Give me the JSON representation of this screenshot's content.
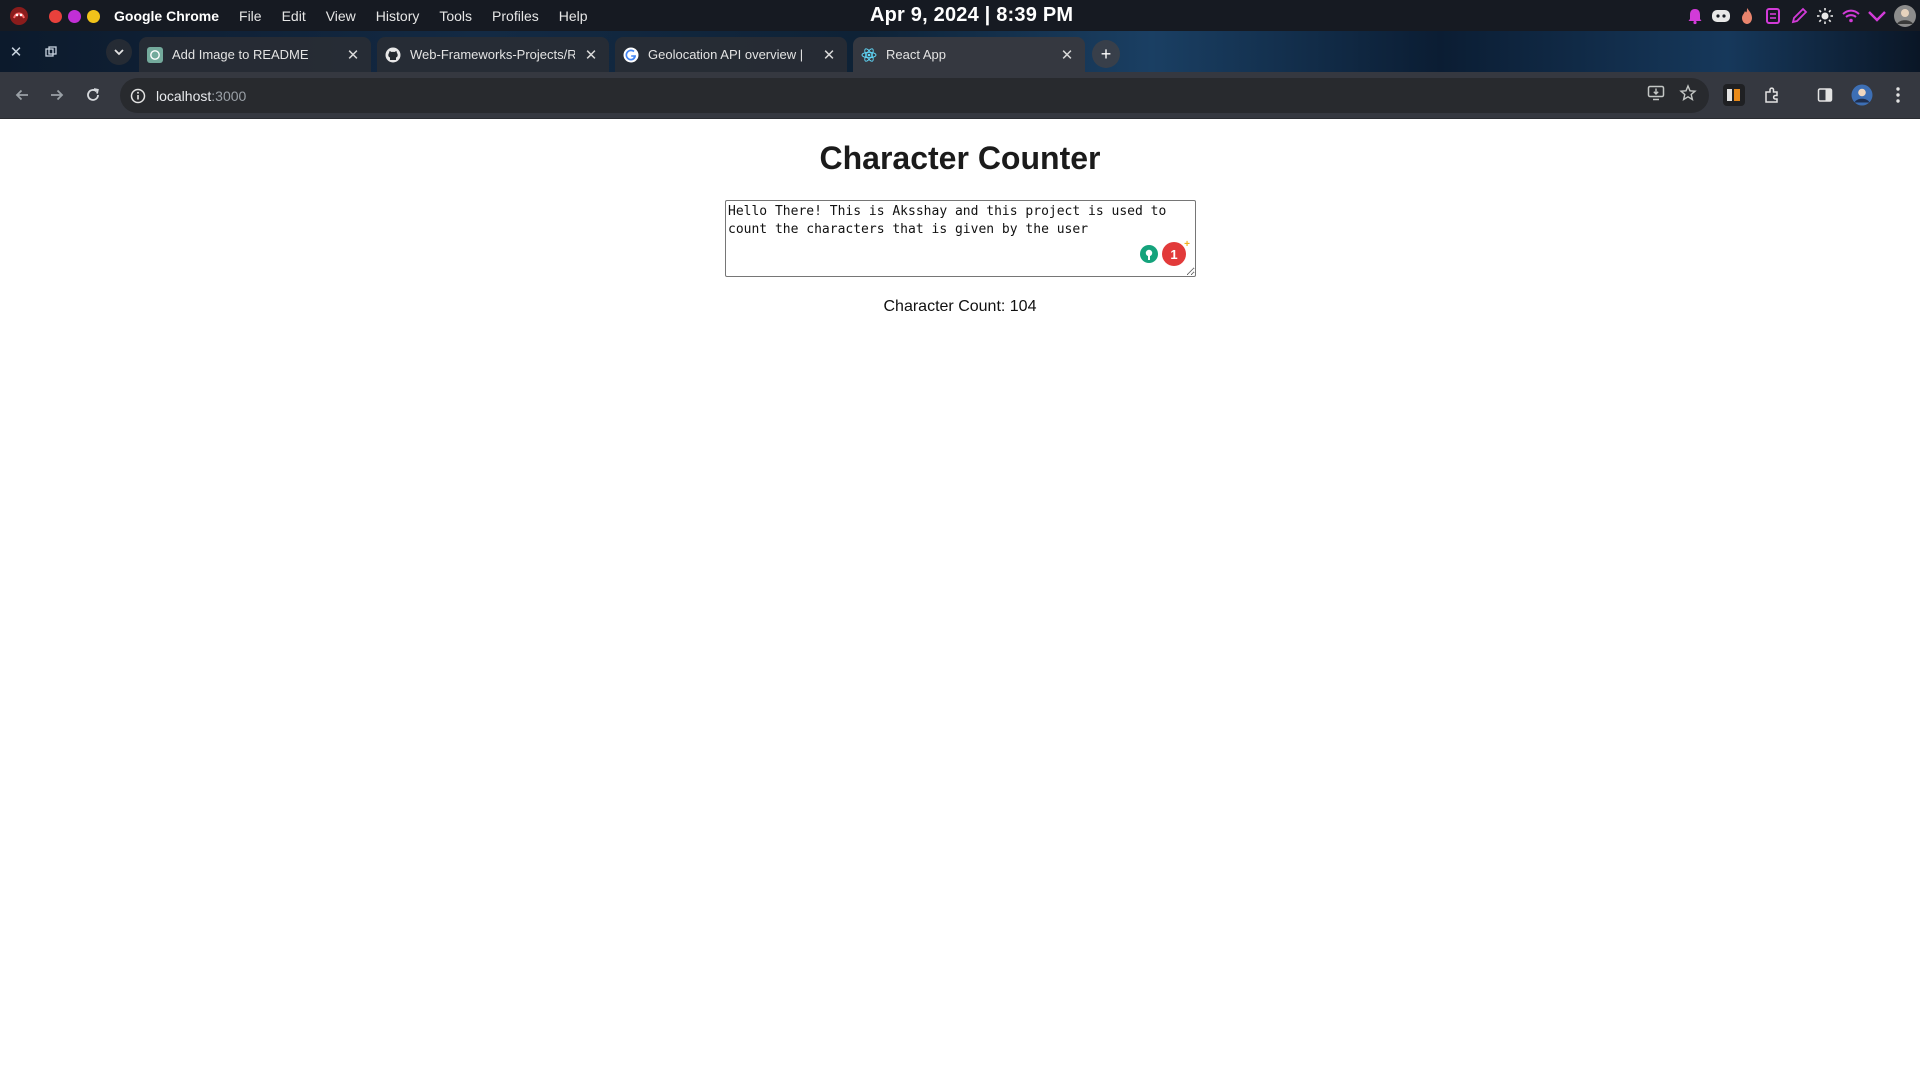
{
  "os_menubar": {
    "app_name": "Google Chrome",
    "menu_items": [
      "File",
      "Edit",
      "View",
      "History",
      "Tools",
      "Profiles",
      "Help"
    ],
    "clock": "Apr 9, 2024 | 8:39 PM",
    "traffic_light_colors": [
      "#e8413c",
      "#c22fd6",
      "#f1c31a"
    ],
    "tray_icons": [
      "bell-icon",
      "discord-icon",
      "flame-icon",
      "notes-icon",
      "pen-icon",
      "brightness-icon",
      "wifi-icon",
      "chevron-icon",
      "user-avatar-icon"
    ]
  },
  "tabs": [
    {
      "title": "Add Image to README",
      "favicon": "chatgpt-icon",
      "active": false
    },
    {
      "title": "Web-Frameworks-Projects/R",
      "favicon": "github-icon",
      "active": false
    },
    {
      "title": "Geolocation API overview  |",
      "favicon": "google-icon",
      "active": false
    },
    {
      "title": "React App",
      "favicon": "react-icon",
      "active": true
    }
  ],
  "toolbar": {
    "url_host": "localhost",
    "url_port": ":3000"
  },
  "page": {
    "title": "Character Counter",
    "textarea_value": "Hello There! This is Aksshay and this project is used to count the characters that is given by the user",
    "grammarly_count": "1",
    "grammarly_plus": "+",
    "char_count_label": "Character Count: 104"
  },
  "colors": {
    "menubar_bg": "#161a22",
    "toolbar_bg": "#353840",
    "omnibox_bg": "#282a2e",
    "page_bg": "#ffffff",
    "accent_red": "#e23a3a",
    "grammarly_green": "#15a37c"
  }
}
